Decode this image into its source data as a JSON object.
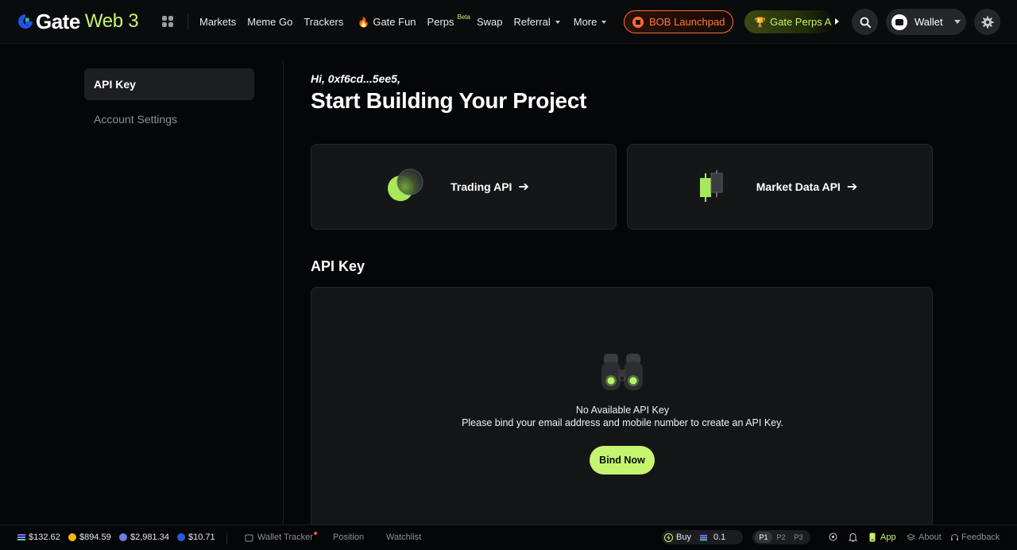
{
  "brand": {
    "name": "Gate",
    "product": "Web 3",
    "accent": "#c5f56e"
  },
  "nav": {
    "items": [
      {
        "label": "Markets"
      },
      {
        "label": "Meme Go"
      },
      {
        "label": "Trackers"
      },
      {
        "label": "Gate Fun",
        "icon": "fire-icon"
      },
      {
        "label": "Perps",
        "badge": "Beta"
      },
      {
        "label": "Swap"
      },
      {
        "label": "Referral",
        "dropdown": true
      },
      {
        "label": "More",
        "dropdown": true
      }
    ],
    "launchpad_label": "BOB Launchpad",
    "perps_promo_label": "Gate Perps A",
    "wallet_label": "Wallet"
  },
  "sidebar": {
    "items": [
      {
        "label": "API Key",
        "active": true
      },
      {
        "label": "Account Settings",
        "active": false
      }
    ]
  },
  "main": {
    "greeting": "Hi, 0xf6cd...5ee5,",
    "title": "Start Building Your Project",
    "cards": [
      {
        "label": "Trading API",
        "icon": "trading-api-icon"
      },
      {
        "label": "Market Data API",
        "icon": "candlestick-icon"
      }
    ],
    "section_title": "API Key",
    "empty_state": {
      "icon": "binoculars-icon",
      "line1": "No Available API Key",
      "line2": "Please bind your email address and mobile number to create an API Key.",
      "button": "Bind Now"
    }
  },
  "footer": {
    "prices": [
      {
        "value": "$132.62",
        "icon": "sol-icon",
        "color": "#9b5cf6"
      },
      {
        "value": "$894.59",
        "icon": "bnb-icon",
        "color": "#f0b90b"
      },
      {
        "value": "$2,981.34",
        "icon": "eth-icon",
        "color": "#6b7fe3"
      },
      {
        "value": "$10.71",
        "icon": "link-icon",
        "color": "#2a5ada"
      }
    ],
    "tabs": [
      "Wallet Tracker",
      "Position",
      "Watchlist"
    ],
    "buy_label": "Buy",
    "buy_amount": "0.1",
    "presets": [
      "P1",
      "P2",
      "P3"
    ],
    "active_preset": "P1",
    "app_label": "App",
    "about_label": "About",
    "feedback_label": "Feedback"
  }
}
